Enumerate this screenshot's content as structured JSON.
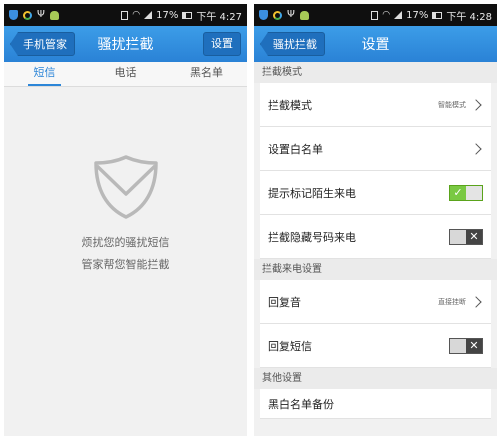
{
  "left": {
    "status": {
      "battery": "17%",
      "time": "下午 4:27"
    },
    "back_label": "手机管家",
    "title": "骚扰拦截",
    "settings_label": "设置",
    "tabs": [
      "短信",
      "电话",
      "黑名单"
    ],
    "empty_line1": "烦扰您的骚扰短信",
    "empty_line2": "管家帮您智能拦截"
  },
  "right": {
    "status": {
      "battery": "17%",
      "time": "下午 4:28"
    },
    "back_label": "骚扰拦截",
    "title": "设置",
    "sections": [
      {
        "header": "拦截模式",
        "rows": [
          {
            "label": "拦截模式",
            "value": "智能模式",
            "control": "chevron"
          },
          {
            "label": "设置白名单",
            "value": "",
            "control": "chevron"
          },
          {
            "label": "提示标记陌生来电",
            "value": "",
            "control": "toggle-on"
          },
          {
            "label": "拦截隐藏号码来电",
            "value": "",
            "control": "toggle-off"
          }
        ]
      },
      {
        "header": "拦截来电设置",
        "rows": [
          {
            "label": "回复音",
            "value": "直接挂断",
            "control": "chevron"
          },
          {
            "label": "回复短信",
            "value": "",
            "control": "toggle-off"
          }
        ]
      },
      {
        "header": "其他设置",
        "rows": [
          {
            "label": "黑白名单备份",
            "value": "",
            "control": "none"
          }
        ]
      }
    ]
  },
  "colors": {
    "accent": "#2c86d8",
    "titlebar": "#3c9de8",
    "toggle_on": "#7ac943",
    "toggle_off": "#444444"
  },
  "icons": [
    "shield-icon",
    "ring-icon",
    "usb-icon",
    "android-icon",
    "vibrate-icon",
    "wifi-icon",
    "signal-icon",
    "battery-icon",
    "chevron-right-icon",
    "envelope-shield-icon"
  ]
}
